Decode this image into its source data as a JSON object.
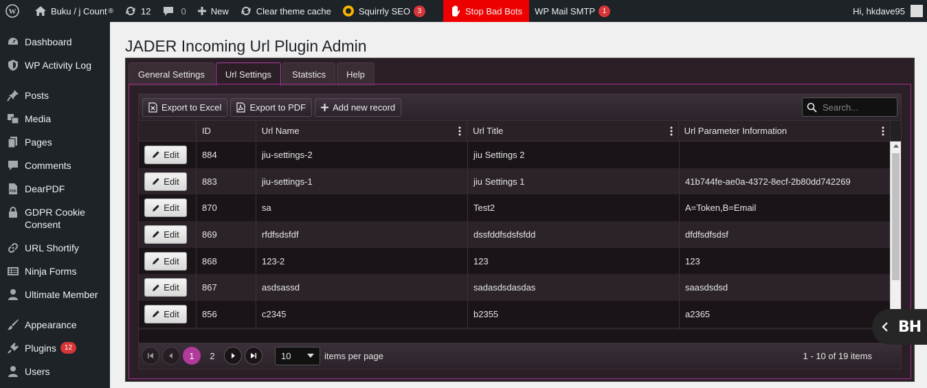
{
  "adminbar": {
    "site_name": "Buku / j Count",
    "updates": "12",
    "comments": "0",
    "new_label": "New",
    "clear_cache": "Clear theme cache",
    "squirrly": "Squirrly SEO",
    "squirrly_badge": "3",
    "stop_bots": "Stop Bad Bots",
    "mail_smtp": "WP Mail SMTP",
    "mail_badge": "1",
    "greeting": "Hi, hkdave95"
  },
  "sidebar": {
    "items": [
      {
        "label": "Dashboard",
        "icon": "dashboard-icon"
      },
      {
        "label": "WP Activity Log",
        "icon": "shield-icon"
      },
      {
        "label": "Posts",
        "icon": "pin-icon"
      },
      {
        "label": "Media",
        "icon": "media-icon"
      },
      {
        "label": "Pages",
        "icon": "pages-icon"
      },
      {
        "label": "Comments",
        "icon": "comment-icon"
      },
      {
        "label": "DearPDF",
        "icon": "pdf-icon"
      },
      {
        "label": "GDPR Cookie Consent",
        "icon": "lock-icon"
      },
      {
        "label": "URL Shortify",
        "icon": "link-icon"
      },
      {
        "label": "Ninja Forms",
        "icon": "form-icon"
      },
      {
        "label": "Ultimate Member",
        "icon": "user-icon"
      },
      {
        "label": "Appearance",
        "icon": "brush-icon"
      },
      {
        "label": "Plugins",
        "icon": "plugin-icon",
        "badge": "12"
      },
      {
        "label": "Users",
        "icon": "users-icon"
      }
    ]
  },
  "page": {
    "title": "JADER Incoming Url Plugin Admin",
    "tabs": [
      "General Settings",
      "Url Settings",
      "Statstics",
      "Help"
    ]
  },
  "grid": {
    "toolbar": {
      "export_excel": "Export to Excel",
      "export_pdf": "Export to PDF",
      "add_record": "Add new record",
      "search_placeholder": "Search..."
    },
    "columns": [
      "ID",
      "Url Name",
      "Url Title",
      "Url Parameter Information"
    ],
    "edit_label": "Edit",
    "rows": [
      {
        "id": "884",
        "name": "jiu-settings-2",
        "title": "jiu Settings 2",
        "param": ""
      },
      {
        "id": "883",
        "name": "jiu-settings-1",
        "title": "jiu Settings 1",
        "param": "41b744fe-ae0a-4372-8ecf-2b80dd742269"
      },
      {
        "id": "870",
        "name": "sa",
        "title": "Test2",
        "param": "A=Token,B=Email"
      },
      {
        "id": "869",
        "name": "rfdfsdsfdf",
        "title": "dssfddfsdsfsfdd",
        "param": "dfdfsdfsdsf"
      },
      {
        "id": "868",
        "name": "123-2",
        "title": "123",
        "param": "123"
      },
      {
        "id": "867",
        "name": "asdsassd",
        "title": "sadasdsdasdas",
        "param": "saasdsdsd"
      },
      {
        "id": "856",
        "name": "c2345",
        "title": "b2355",
        "param": "a2365"
      },
      {
        "id": "",
        "name": "",
        "title": "",
        "param": ""
      }
    ],
    "pager": {
      "pages": [
        "1",
        "2"
      ],
      "page_size": "10",
      "items_label": "items per page",
      "info": "1 - 10 of 19 items"
    }
  },
  "badge": {
    "text": "BH"
  }
}
